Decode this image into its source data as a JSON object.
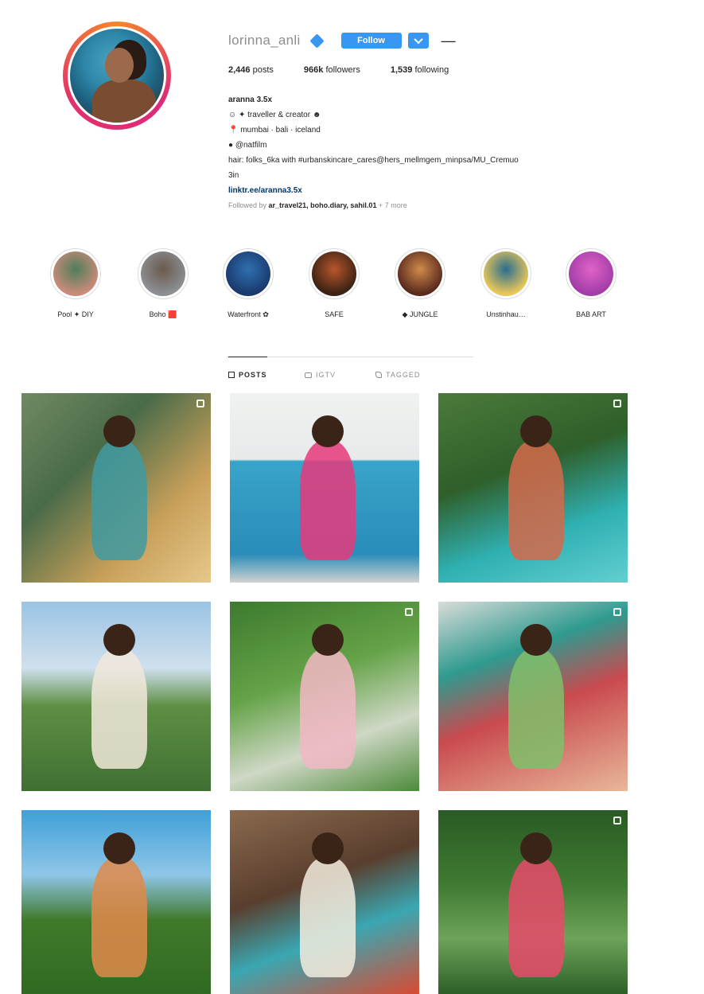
{
  "profile": {
    "username": "lorinna_anli",
    "follow_label": "Follow",
    "posts_count": "2,446",
    "posts_label": "posts",
    "followers_count": "966k",
    "followers_label": "followers",
    "following_count": "1,539",
    "following_label": "following",
    "display_name": "aranna 3.5x",
    "bio_lines": [
      "☺ ✦ traveller & creator ☻",
      "📍 mumbai · bali · iceland",
      "● @natfilm",
      "hair: folks_6ka with #urbanskincare_cares@hers_mellmgem_minpsa/MU_Cremuo",
      "3in"
    ],
    "link": "linktr.ee/aranna3.5x",
    "followed_by_prefix": "Followed by",
    "followed_by_names": "ar_travel21, boho.diary, sahil.01",
    "followed_by_suffix": "+ 7 more"
  },
  "highlights": [
    {
      "label": "Pool ✦ DIY",
      "color_a": "#c98b7a",
      "color_b": "#4f7d5a"
    },
    {
      "label": "Boho 🟥",
      "color_a": "#8c8f94",
      "color_b": "#6b5a4c"
    },
    {
      "label": "Waterfront ✿",
      "color_a": "#1a3a6e",
      "color_b": "#2f6fb0"
    },
    {
      "label": "SAFE",
      "color_a": "#3b2214",
      "color_b": "#b8562b"
    },
    {
      "label": "◆ JUNGLE",
      "color_a": "#5a2a1e",
      "color_b": "#d08b4a"
    },
    {
      "label": "Unstinhau…",
      "color_a": "#e8c65a",
      "color_b": "#2a6d8f"
    },
    {
      "label": "BAB ART",
      "color_a": "#a23da8",
      "color_b": "#e062c8"
    }
  ],
  "tabs": [
    {
      "label": "POSTS",
      "icon": "grid-icon",
      "active": true
    },
    {
      "label": "IGTV",
      "icon": "tv-icon",
      "active": false
    },
    {
      "label": "TAGGED",
      "icon": "tag-icon",
      "active": false
    }
  ],
  "posts": [
    {
      "bg": "linear-gradient(135deg,#6f8a63 0%,#4a6b48 35%,#c9a05b 70%,#e6c88a 100%)",
      "fig": "#3f9aa2",
      "multi": true
    },
    {
      "bg": "linear-gradient(180deg,#f0f2f0 0%,#e7eaea 35%,#39a4c9 36%,#2a8cb8 85%,#cfd2cf 100%)",
      "fig": "#e6397b",
      "multi": false
    },
    {
      "bg": "linear-gradient(160deg,#4c7a3b 0%,#2f5f2a 40%,#2fb0b2 70%,#62cfd0 100%)",
      "fig": "#d46a4b",
      "multi": true
    },
    {
      "bg": "linear-gradient(180deg,#9bc3e3 0%,#cfe0ee 35%,#5f8f44 55%,#3f7032 100%)",
      "fig": "#f1e8da",
      "multi": false
    },
    {
      "bg": "linear-gradient(160deg,#3d7a2f 0%,#64a347 40%,#cfd8c6 70%,#4d8a3a 100%)",
      "fig": "#f2b7c4",
      "multi": true
    },
    {
      "bg": "linear-gradient(160deg,#d9dcd8 0%,#2f9a8f 30%,#c94a4f 55%,#e8b79a 100%)",
      "fig": "#7fbf6a",
      "multi": true
    },
    {
      "bg": "linear-gradient(180deg,#3fa0d8 0%,#8fc6e8 35%,#3f7a2a 60%,#2f6a22 100%)",
      "fig": "#e08a4a",
      "multi": false
    },
    {
      "bg": "linear-gradient(160deg,#8a6a4e 0%,#5a3e2e 40%,#3aa7b2 65%,#d94a32 100%)",
      "fig": "#f2ecde",
      "multi": false
    },
    {
      "bg": "linear-gradient(180deg,#2a5a24 0%,#3f7a32 40%,#6ea35a 70%,#2e5f28 100%)",
      "fig": "#e84a6a",
      "multi": true
    }
  ]
}
